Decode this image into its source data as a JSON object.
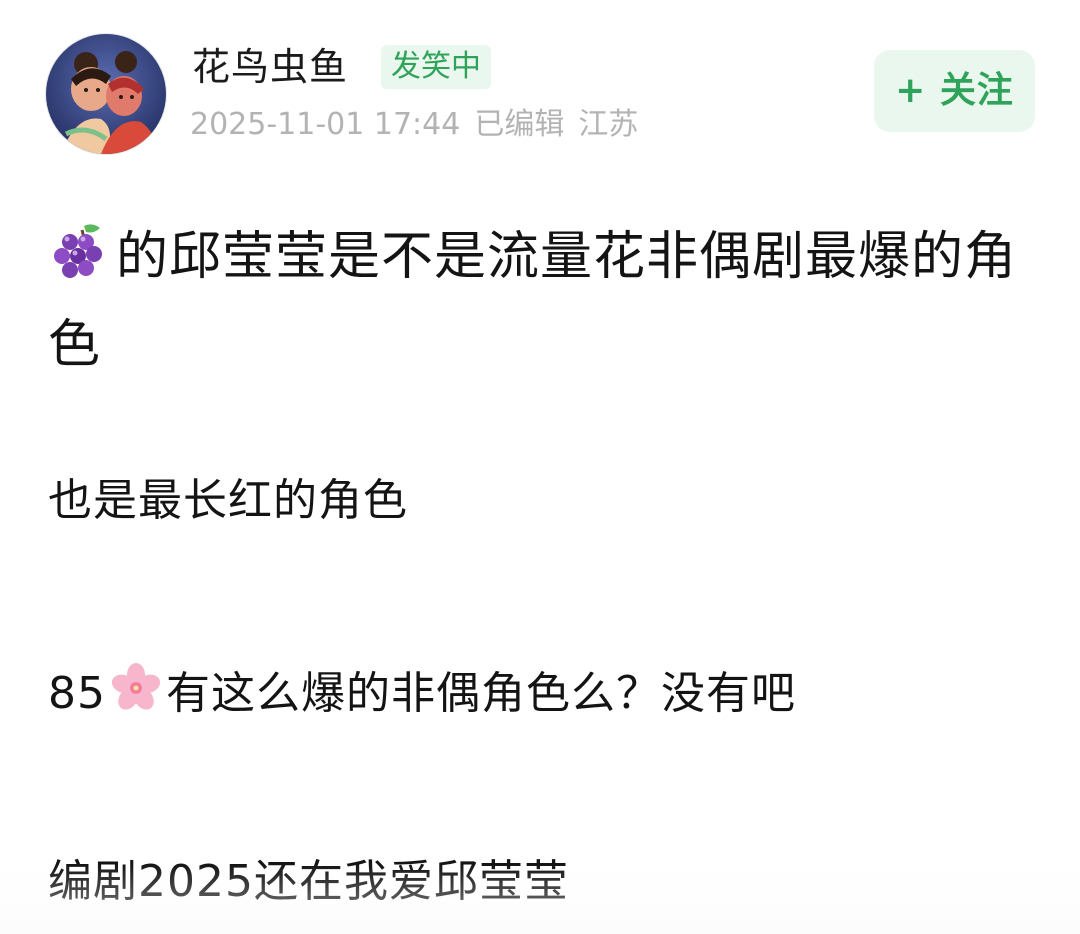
{
  "header": {
    "username": "花鸟虫鱼",
    "status_badge": "发笑中",
    "timestamp": "2025-11-01 17:44",
    "edited_label": "已编辑",
    "location": "江苏",
    "follow_button": "+ 关注"
  },
  "post": {
    "title_emoji": "grape-emoji",
    "title": "的邱莹莹是不是流量花非偶剧最爆的角色",
    "paragraph_1": "也是最长红的角色",
    "paragraph_2_prefix": "85",
    "paragraph_2_emoji": "cherry-blossom-emoji",
    "paragraph_2_suffix": "有这么爆的非偶角色么？没有吧",
    "paragraph_3": "编剧2025还在我爱邱莹莹"
  },
  "colors": {
    "accent_green": "#2fa35a",
    "badge_bg": "#eaf7ee",
    "meta_gray": "#b3b3b3",
    "text": "#141414"
  }
}
